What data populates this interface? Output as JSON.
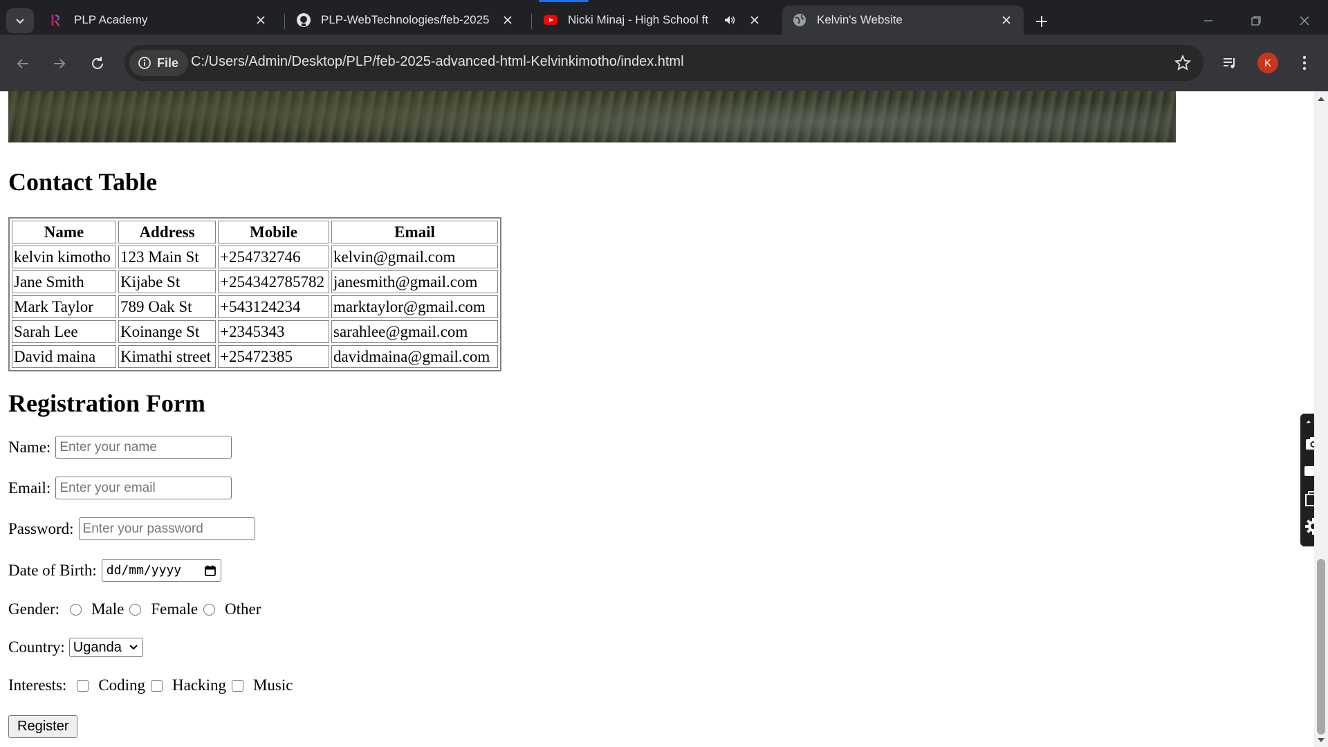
{
  "browser": {
    "tabs": [
      {
        "title": "PLP Academy",
        "icon": "plp-favicon",
        "active": false
      },
      {
        "title": "PLP-WebTechnologies/feb-2025",
        "icon": "github-icon",
        "active": false
      },
      {
        "title": "Nicki Minaj - High School ft",
        "icon": "youtube-icon",
        "active": false,
        "audio": true
      },
      {
        "title": "Kelvin's Website",
        "icon": "globe-icon",
        "active": true
      }
    ],
    "site_chip_label": "File",
    "url": "C:/Users/Admin/Desktop/PLP/feb-2025-advanced-html-Kelvinkimotho/index.html",
    "profile_initial": "K",
    "accent_color": "#1a73e8"
  },
  "page": {
    "contact_heading": "Contact Table",
    "contacts": {
      "headers": [
        "Name",
        "Address",
        "Mobile",
        "Email"
      ],
      "rows": [
        [
          "kelvin kimotho",
          "123 Main St",
          "+254732746",
          "kelvin@gmail.com"
        ],
        [
          "Jane Smith",
          "Kijabe St",
          "+254342785782",
          "janesmith@gmail.com"
        ],
        [
          "Mark Taylor",
          "789 Oak St",
          "+543124234",
          "marktaylor@gmail.com"
        ],
        [
          "Sarah Lee",
          "Koinange St",
          "+2345343",
          "sarahlee@gmail.com"
        ],
        [
          "David maina",
          "Kimathi street",
          "+25472385",
          "davidmaina@gmail.com"
        ]
      ]
    },
    "registration_heading": "Registration Form",
    "form": {
      "name_label": "Name:",
      "name_placeholder": "Enter your name",
      "email_label": "Email:",
      "email_placeholder": "Enter your email",
      "password_label": "Password:",
      "password_placeholder": "Enter your password",
      "dob_label": "Date of Birth:",
      "dob_value": "dd/mm/yyyy",
      "gender_label": "Gender:",
      "gender_options": [
        "Male",
        "Female",
        "Other"
      ],
      "country_label": "Country:",
      "country_selected": "Uganda",
      "interests_label": "Interests:",
      "interest_options": [
        "Coding",
        "Hacking",
        "Music"
      ],
      "submit_label": "Register"
    }
  }
}
